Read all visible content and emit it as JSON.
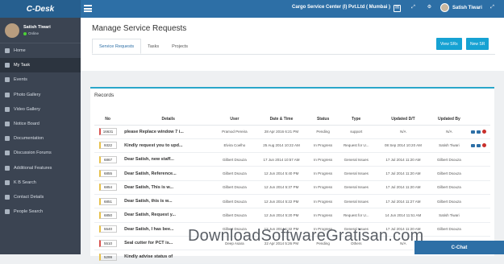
{
  "app": {
    "brand": "C-Desk",
    "org": "Cargo Service Center (I) Pvt.Ltd ( Mumbai )",
    "user": "Satish Tiwari"
  },
  "profile": {
    "name": "Satish Tiwari",
    "status": "Online"
  },
  "sidebar": {
    "items": [
      {
        "label": "Home",
        "active": false
      },
      {
        "label": "My Task",
        "active": true
      },
      {
        "label": "Events",
        "active": false
      },
      {
        "label": "Photo Gallery",
        "active": false
      },
      {
        "label": "Video Gallery",
        "active": false
      },
      {
        "label": "Notice Board",
        "active": false
      },
      {
        "label": "Documentation",
        "active": false
      },
      {
        "label": "Discussion Forums",
        "active": false
      },
      {
        "label": "Additional Features",
        "active": false
      },
      {
        "label": "K B Search",
        "active": false
      },
      {
        "label": "Contact Details",
        "active": false
      },
      {
        "label": "People Search",
        "active": false
      }
    ]
  },
  "page": {
    "title": "Manage Service Requests",
    "tabs": [
      "Service Requests",
      "Tasks",
      "Projects"
    ],
    "view_btn": "View SRs",
    "new_btn": "New SR"
  },
  "records": {
    "title": "Records",
    "headers": [
      "No",
      "Details",
      "User",
      "Date & Time",
      "Status",
      "Type",
      "Updated D/T",
      "Updated By"
    ],
    "rows": [
      {
        "no": "16631",
        "details": "please Replace window 7 i...",
        "user": "Pramod Pereira",
        "dt": "28 Apr 2016 6:21 PM",
        "status": "Pending",
        "type": "support",
        "upd": "N/A",
        "by": "N/A",
        "flag": "red"
      },
      {
        "no": "9322",
        "details": "Kindly request you to upd...",
        "user": "Elvira Coelho",
        "dt": "25 Aug 2014 10:22 AM",
        "status": "In Progress",
        "type": "Request for U...",
        "upd": "08 Sep 2014 10:20 AM",
        "by": "Satish Tiwari",
        "flag": "yellow"
      },
      {
        "no": "6867",
        "details": "Dear Satish, new staff...",
        "user": "Gilbert Dsouza",
        "dt": "17 Jun 2014 10:57 AM",
        "status": "In Progress",
        "type": "General Issues",
        "upd": "17 Jul 2014 11:20 AM",
        "by": "Gilbert Dsouza",
        "flag": "yellow"
      },
      {
        "no": "6855",
        "details": "Dear Satish, Reference...",
        "user": "Gilbert Dsouza",
        "dt": "12 Jun 2014 5:40 PM",
        "status": "In Progress",
        "type": "General Issues",
        "upd": "17 Jul 2014 11:20 AM",
        "by": "Gilbert Dsouza",
        "flag": "yellow"
      },
      {
        "no": "6854",
        "details": "Dear Satish, This is w...",
        "user": "Gilbert Dsouza",
        "dt": "12 Jun 2014 5:37 PM",
        "status": "In Progress",
        "type": "General Issues",
        "upd": "17 Jul 2014 11:20 AM",
        "by": "Gilbert Dsouza",
        "flag": "yellow"
      },
      {
        "no": "6851",
        "details": "Dear Satish, this is w...",
        "user": "Gilbert Dsouza",
        "dt": "12 Jun 2014 5:22 PM",
        "status": "In Progress",
        "type": "General Issues",
        "upd": "17 Jul 2014 11:27 AM",
        "by": "Gilbert Dsouza",
        "flag": "yellow"
      },
      {
        "no": "6850",
        "details": "Dear Satish, Request y...",
        "user": "Gilbert Dsouza",
        "dt": "12 Jun 2014 5:20 PM",
        "status": "In Progress",
        "type": "Request for U...",
        "upd": "14 Jun 2014 11:51 AM",
        "by": "Satish Tiwari",
        "flag": "yellow"
      },
      {
        "no": "5540",
        "details": "Dear Satish, I has bee...",
        "user": "Gilbert Dsouza",
        "dt": "12 Jun 2014 1:32 PM",
        "status": "In Progress",
        "type": "General Issues",
        "upd": "17 Jul 2014 11:20 AM",
        "by": "Gilbert Dsouza",
        "flag": "yellow"
      },
      {
        "no": "5510",
        "details": "Seal cutter for PCT is...",
        "user": "Deep Asara",
        "dt": "22 Apr 2014 5:26 PM",
        "status": "Pending",
        "type": "Others",
        "upd": "N/A",
        "by": "N/A",
        "flag": "red"
      },
      {
        "no": "5299",
        "details": "Kindly advise status of",
        "user": "",
        "dt": "",
        "status": "",
        "type": "",
        "upd": "",
        "by": "",
        "flag": "yellow"
      }
    ]
  },
  "watermark": "DownloadSoftwareGratisan.com",
  "chat": "C-Chat"
}
